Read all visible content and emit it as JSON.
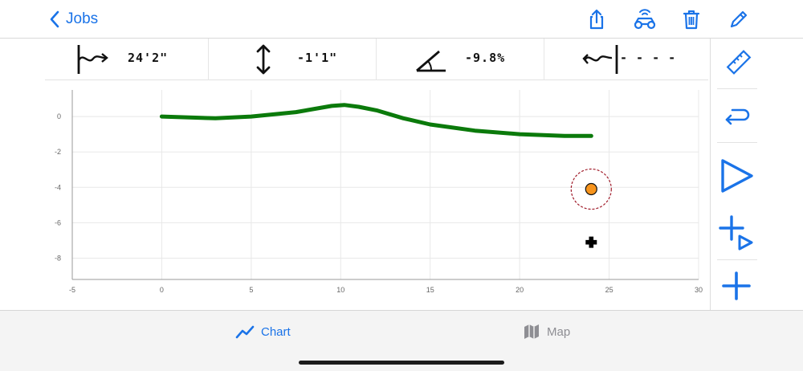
{
  "nav": {
    "back_label": "Jobs",
    "icons": [
      "share-icon",
      "vehicle-signal-icon",
      "trash-icon",
      "pencil-icon"
    ]
  },
  "measurements": [
    {
      "icon": "horizontal-distance-icon",
      "value": "24'2\""
    },
    {
      "icon": "vertical-distance-icon",
      "value": "-1'1\""
    },
    {
      "icon": "grade-angle-icon",
      "value": "-9.8%"
    },
    {
      "icon": "remaining-distance-icon",
      "value": "- - - -"
    }
  ],
  "tools": [
    "ruler-icon",
    "return-arrow-icon",
    "play-icon",
    "add-and-play-icon",
    "add-icon"
  ],
  "chart_data": {
    "type": "line",
    "xlim": [
      -5,
      30
    ],
    "ylim": [
      -9.2,
      1.5
    ],
    "x_ticks": [
      -5,
      0,
      5,
      10,
      15,
      20,
      25,
      30
    ],
    "y_ticks": [
      0,
      -2,
      -4,
      -6,
      -8
    ],
    "grid": true,
    "series": [
      {
        "color": "#0b7a0b",
        "points": [
          [
            0,
            0
          ],
          [
            3,
            -0.1
          ],
          [
            5,
            0
          ],
          [
            7.5,
            0.25
          ],
          [
            9.5,
            0.6
          ],
          [
            10.2,
            0.65
          ],
          [
            11,
            0.55
          ],
          [
            12,
            0.35
          ],
          [
            13.5,
            -0.1
          ],
          [
            15,
            -0.45
          ],
          [
            17.5,
            -0.8
          ],
          [
            20,
            -1.0
          ],
          [
            22.5,
            -1.1
          ],
          [
            24,
            -1.1
          ]
        ]
      }
    ],
    "markers": [
      {
        "type": "current-position",
        "x": 24,
        "y": -4.1,
        "color": "#f7941d",
        "ring_color": "#a01c2a"
      },
      {
        "type": "target-cross",
        "x": 24,
        "y": -7.1,
        "color": "#000000"
      }
    ]
  },
  "tabs": [
    {
      "label": "Chart",
      "icon": "line-chart-icon",
      "active": true
    },
    {
      "label": "Map",
      "icon": "map-icon",
      "active": false
    }
  ],
  "colors": {
    "accent": "#1a73e8",
    "line": "#0b7a0b",
    "marker": "#f7941d",
    "inactive": "#8e8e93"
  }
}
